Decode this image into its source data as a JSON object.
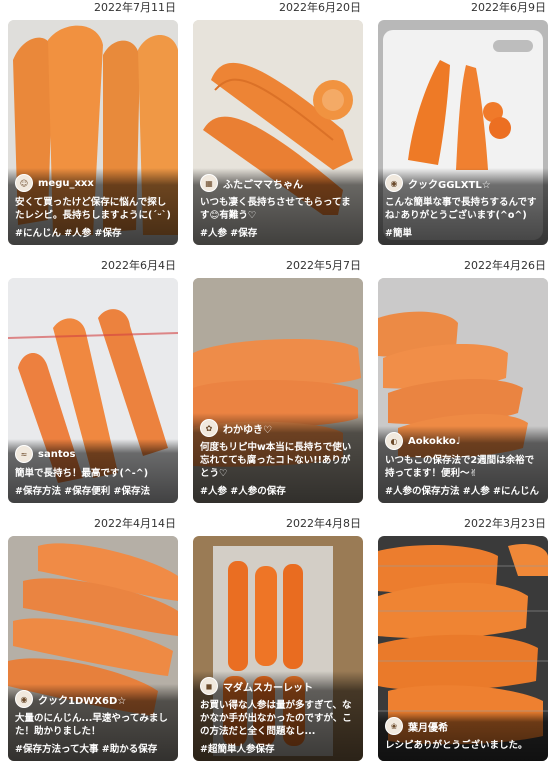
{
  "cards": [
    {
      "date": "2022年7月11日",
      "user": "megu_xxx",
      "comment": "安くて買ったけど保存に悩んで探したレシピ。長持ちしますように(´ᵕ`)",
      "tags": "#にんじん #人参 #保存",
      "avatar_icon": "face-avatar-icon"
    },
    {
      "date": "2022年6月20日",
      "user": "ふたごママちゃん",
      "comment": "いつも凄く長持ちさせてもらってます😊有難う♡",
      "tags": "#人参 #保存",
      "avatar_icon": "pattern-avatar-icon"
    },
    {
      "date": "2022年6月9日",
      "user": "クックGGLXTL☆",
      "comment": "こんな簡単な事で長持ちするんですね♪ありがとうございます(^o^)",
      "tags": "#簡単",
      "avatar_icon": "chef-avatar-icon"
    },
    {
      "date": "2022年6月4日",
      "user": "santos",
      "comment": "簡単で長持ち！最高です(^-^)",
      "tags": "#保存方法 #保存便利 #保存法",
      "avatar_icon": "wave-avatar-icon"
    },
    {
      "date": "2022年5月7日",
      "user": "わかゆき♡",
      "comment": "何度もリピ中w本当に長持ちで使い忘れてても腐ったコトない!!ありがとう♡",
      "tags": "#人参 #人参の保存",
      "avatar_icon": "flower-avatar-icon"
    },
    {
      "date": "2022年4月26日",
      "user": "Aokokko♩",
      "comment": "いつもこの保存法で2週間は余裕で持ってます！便利〜✌",
      "tags": "#人参の保存方法 #人参 #にんじん",
      "avatar_icon": "photo-avatar-icon"
    },
    {
      "date": "2022年4月14日",
      "user": "クック1DWX6D☆",
      "comment": "大量のにんじん...早速やってみました！助かりました！",
      "tags": "#保存方法って大事 #助かる保存",
      "avatar_icon": "chef-avatar-icon"
    },
    {
      "date": "2022年4月8日",
      "user": "マダムスカーレット",
      "comment": "お買い得な人参は量が多すぎて、なかなか手が出なかったのですが、この方法だと全く問題なし...",
      "tags": "#超簡単人参保存",
      "avatar_icon": "car-avatar-icon"
    },
    {
      "date": "2022年3月23日",
      "user": "葉月優希",
      "comment": "レシピありがとうございました。",
      "tags": "",
      "avatar_icon": "leaf-avatar-icon"
    }
  ]
}
